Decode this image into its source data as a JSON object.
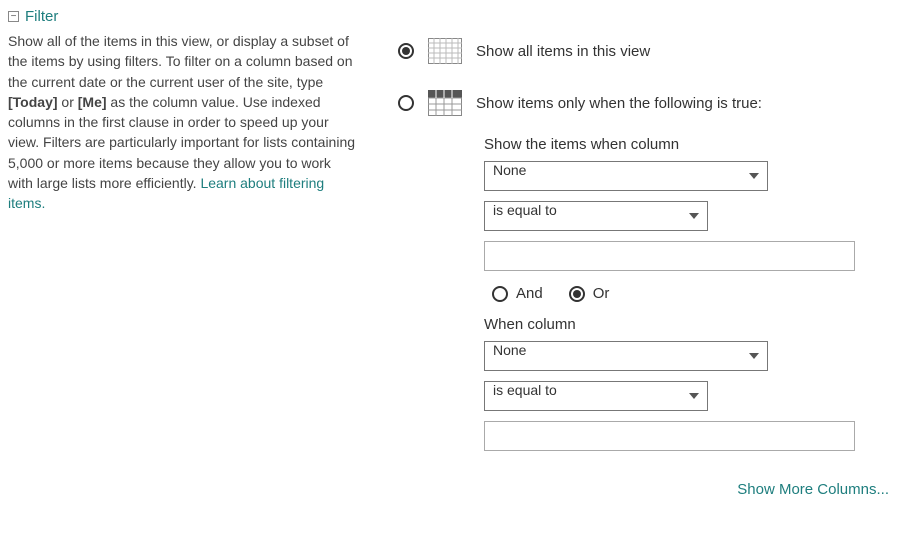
{
  "section": {
    "toggle_glyph": "−",
    "title": "Filter",
    "desc_part1": "Show all of the items in this view, or display a subset of the items by using filters. To filter on a column based on the current date or the current user of the site, type ",
    "today": "[Today]",
    "or": " or ",
    "me": "[Me]",
    "desc_part2": " as the column value. Use indexed columns in the first clause in order to speed up your view. Filters are particularly important for lists containing 5,000 or more items because they allow you to work with large lists more efficiently. ",
    "learn_link": "Learn about filtering items."
  },
  "options": {
    "show_all": "Show all items in this view",
    "show_filtered": "Show items only when the following is true:",
    "selected": "show_all"
  },
  "group1": {
    "label": "Show the items when column",
    "column": "None",
    "operator": "is equal to",
    "value": ""
  },
  "logic": {
    "and": "And",
    "or": "Or",
    "selected": "or"
  },
  "group2": {
    "label": "When column",
    "column": "None",
    "operator": "is equal to",
    "value": ""
  },
  "footer": {
    "more": "Show More Columns..."
  }
}
